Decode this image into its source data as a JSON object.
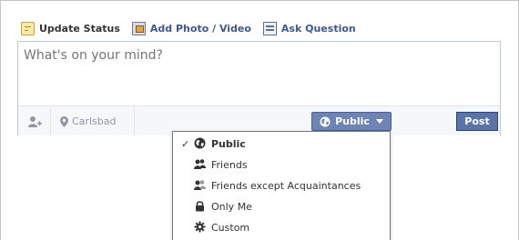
{
  "composer_tabs": [
    {
      "label": "Update Status",
      "icon": "status-icon"
    },
    {
      "label": "Add Photo / Video",
      "icon": "photo-icon"
    },
    {
      "label": "Ask Question",
      "icon": "question-icon"
    }
  ],
  "composer": {
    "placeholder": "What's on your mind?",
    "location_label": "Carlsbad",
    "privacy_label": "Public",
    "post_label": "Post"
  },
  "privacy_menu": {
    "items": [
      {
        "label": "Public",
        "icon": "globe-icon",
        "selected": true
      },
      {
        "label": "Friends",
        "icon": "friends-icon",
        "selected": false
      },
      {
        "label": "Friends except Acquaintances",
        "icon": "friends-except-icon",
        "selected": false
      },
      {
        "label": "Only Me",
        "icon": "lock-icon",
        "selected": false
      },
      {
        "label": "Custom",
        "icon": "gear-icon",
        "selected": false
      }
    ],
    "check_glyph": "✓"
  },
  "colors": {
    "link": "#3b5998",
    "privacy_button": "#6d84b4",
    "post_button": "#5b74a8"
  }
}
